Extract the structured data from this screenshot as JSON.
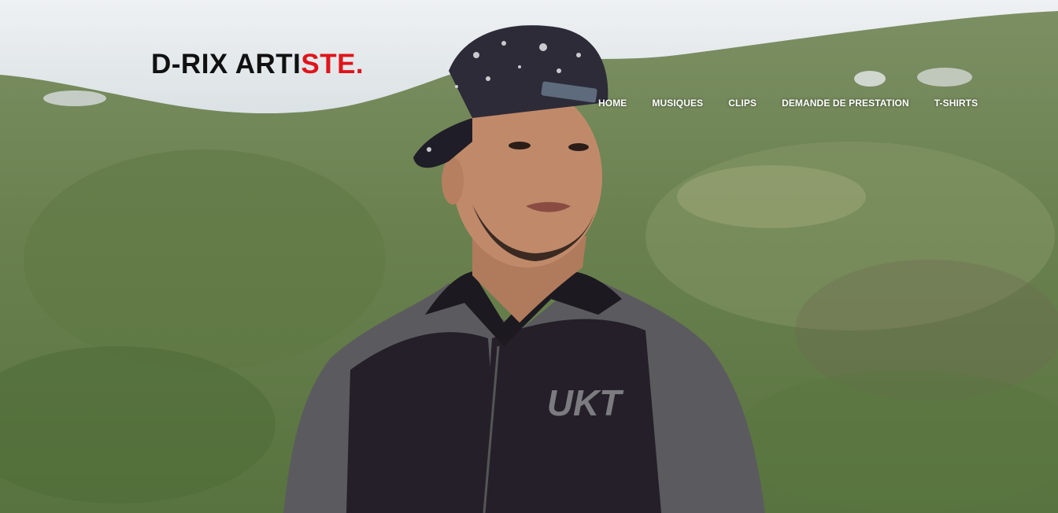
{
  "site": {
    "logo_main": "D-RIX ARTI",
    "logo_accent": "STE.",
    "accent_color": "#e0141b"
  },
  "nav": {
    "items": [
      {
        "label": "HOME"
      },
      {
        "label": "MUSIQUES"
      },
      {
        "label": "CLIPS"
      },
      {
        "label": "DEMANDE DE PRESTATION"
      },
      {
        "label": "T-SHIRTS"
      }
    ]
  },
  "hero": {
    "jacket_brand": "UKT"
  }
}
